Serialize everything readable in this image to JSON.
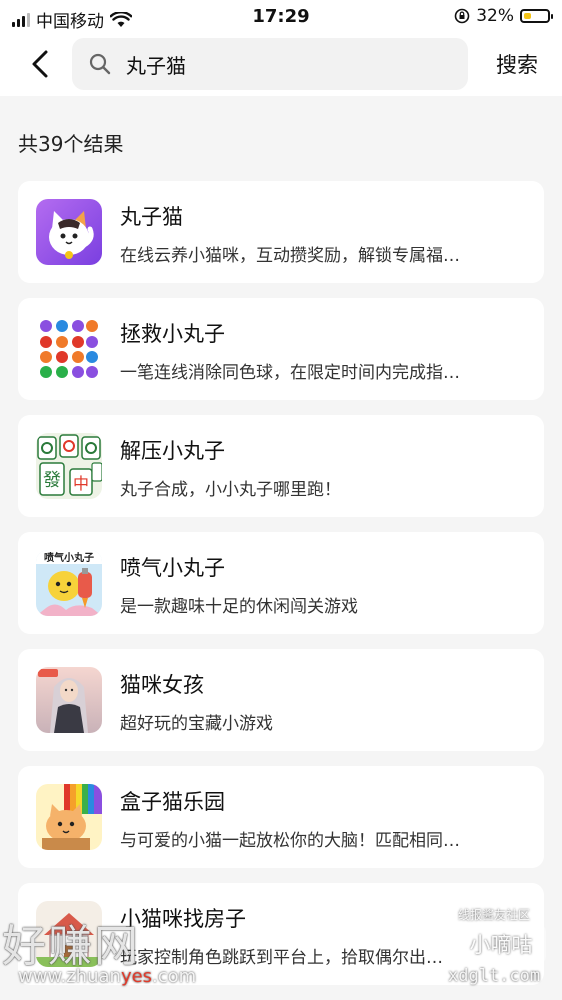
{
  "status_bar": {
    "carrier": "中国移动",
    "time": "17:29",
    "battery_percent": "32%",
    "battery_level": 0.32
  },
  "search": {
    "query": "丸子猫",
    "button_label": "搜索"
  },
  "result_count": "共39个结果",
  "results": [
    {
      "title": "丸子猫",
      "desc": "在线云养小猫咪，互动攒奖励，解锁专属福…",
      "icon": "cat-app-icon"
    },
    {
      "title": "拯救小丸子",
      "desc": "一笔连线消除同色球，在限定时间内完成指…",
      "icon": "colored-balls-app-icon"
    },
    {
      "title": "解压小丸子",
      "desc": "丸子合成，小小丸子哪里跑！",
      "icon": "mahjong-app-icon"
    },
    {
      "title": "喷气小丸子",
      "desc": "是一款趣味十足的休闲闯关游戏",
      "icon": "jet-ball-app-icon"
    },
    {
      "title": "猫咪女孩",
      "desc": "超好玩的宝藏小游戏",
      "icon": "girl-app-icon"
    },
    {
      "title": "盒子猫乐园",
      "desc": "与可爱的小猫一起放松你的大脑！匹配相同…",
      "icon": "box-cat-app-icon"
    },
    {
      "title": "小猫咪找房子",
      "desc": "玩家控制角色跳跃到平台上，拾取偶尔出…",
      "icon": "house-app-icon"
    }
  ],
  "watermarks": {
    "left_brand": "好赚网",
    "left_url_a": "www.zhuan",
    "left_url_b": "yes",
    "left_url_c": ".com",
    "right_top": "线报酱友社区",
    "right_brand": "小嘀咕",
    "right_url": "xdglt.com"
  },
  "colors": {
    "background": "#f5f5f5",
    "card": "#ffffff",
    "battery_fill": "#f5c518"
  }
}
